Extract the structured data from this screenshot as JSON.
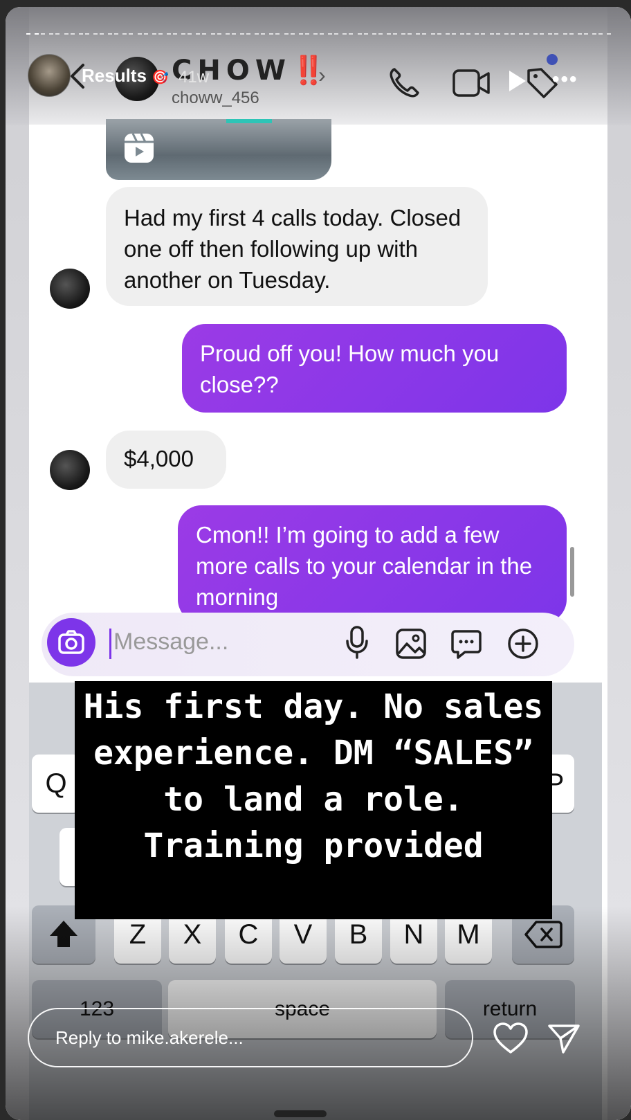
{
  "story": {
    "title": "Results",
    "emoji": "🎯",
    "time": "41w",
    "reply_placeholder": "Reply to mike.akerele..."
  },
  "chat": {
    "name": "CHOW",
    "name_suffix": "‼️",
    "username": "choww_456"
  },
  "messages": [
    {
      "from": "them",
      "text": "Had my first 4 calls today. Closed one off then following up with another on Tuesday."
    },
    {
      "from": "me",
      "text": "Proud off you! How much you close??"
    },
    {
      "from": "them",
      "text": "$4,000"
    },
    {
      "from": "me",
      "text": "Cmon!! I’m going to add a few more calls to your calendar in the morning"
    }
  ],
  "composer": {
    "placeholder": "Message..."
  },
  "keyboard": {
    "q": "Q",
    "p": "P",
    "z": "Z",
    "x": "X",
    "c": "C",
    "v": "V",
    "b": "B",
    "n": "N",
    "m": "M",
    "numbers": "123",
    "space": "space",
    "return": "return"
  },
  "overlay_text": "His first day. No sales experience. DM “SALES” to land a role. Training provided",
  "colors": {
    "accent": "#7d35e9",
    "outgoing_bubble": "#8b38e8",
    "incoming_bubble": "#efefef"
  }
}
